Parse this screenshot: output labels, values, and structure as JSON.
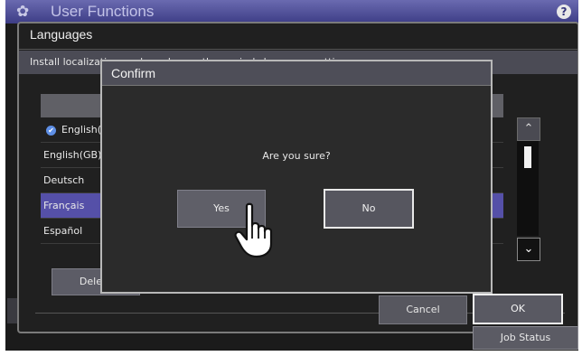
{
  "app": {
    "title": "User Functions",
    "settings_icon": "gear-icon",
    "help_icon": "help-icon",
    "help_glyph": "?"
  },
  "panel": {
    "title": "Languages",
    "instruction": "Install localization pack or change the copier's language setting."
  },
  "languages": [
    {
      "label": "English(U",
      "current": true
    },
    {
      "label": "English(GB)",
      "current": false
    },
    {
      "label": "Deutsch",
      "current": false
    },
    {
      "label": "Français",
      "current": false,
      "selected": true
    },
    {
      "label": "Español",
      "current": false
    }
  ],
  "buttons": {
    "delete": "Delete",
    "cancel": "Cancel",
    "ok": "OK",
    "job_status": "Job Status"
  },
  "dialog": {
    "title": "Confirm",
    "message": "Are you sure?",
    "yes": "Yes",
    "no": "No"
  },
  "colors": {
    "accent": "#5550a8",
    "title_bar": "#4a4a96",
    "check": "#5e8fe6"
  }
}
